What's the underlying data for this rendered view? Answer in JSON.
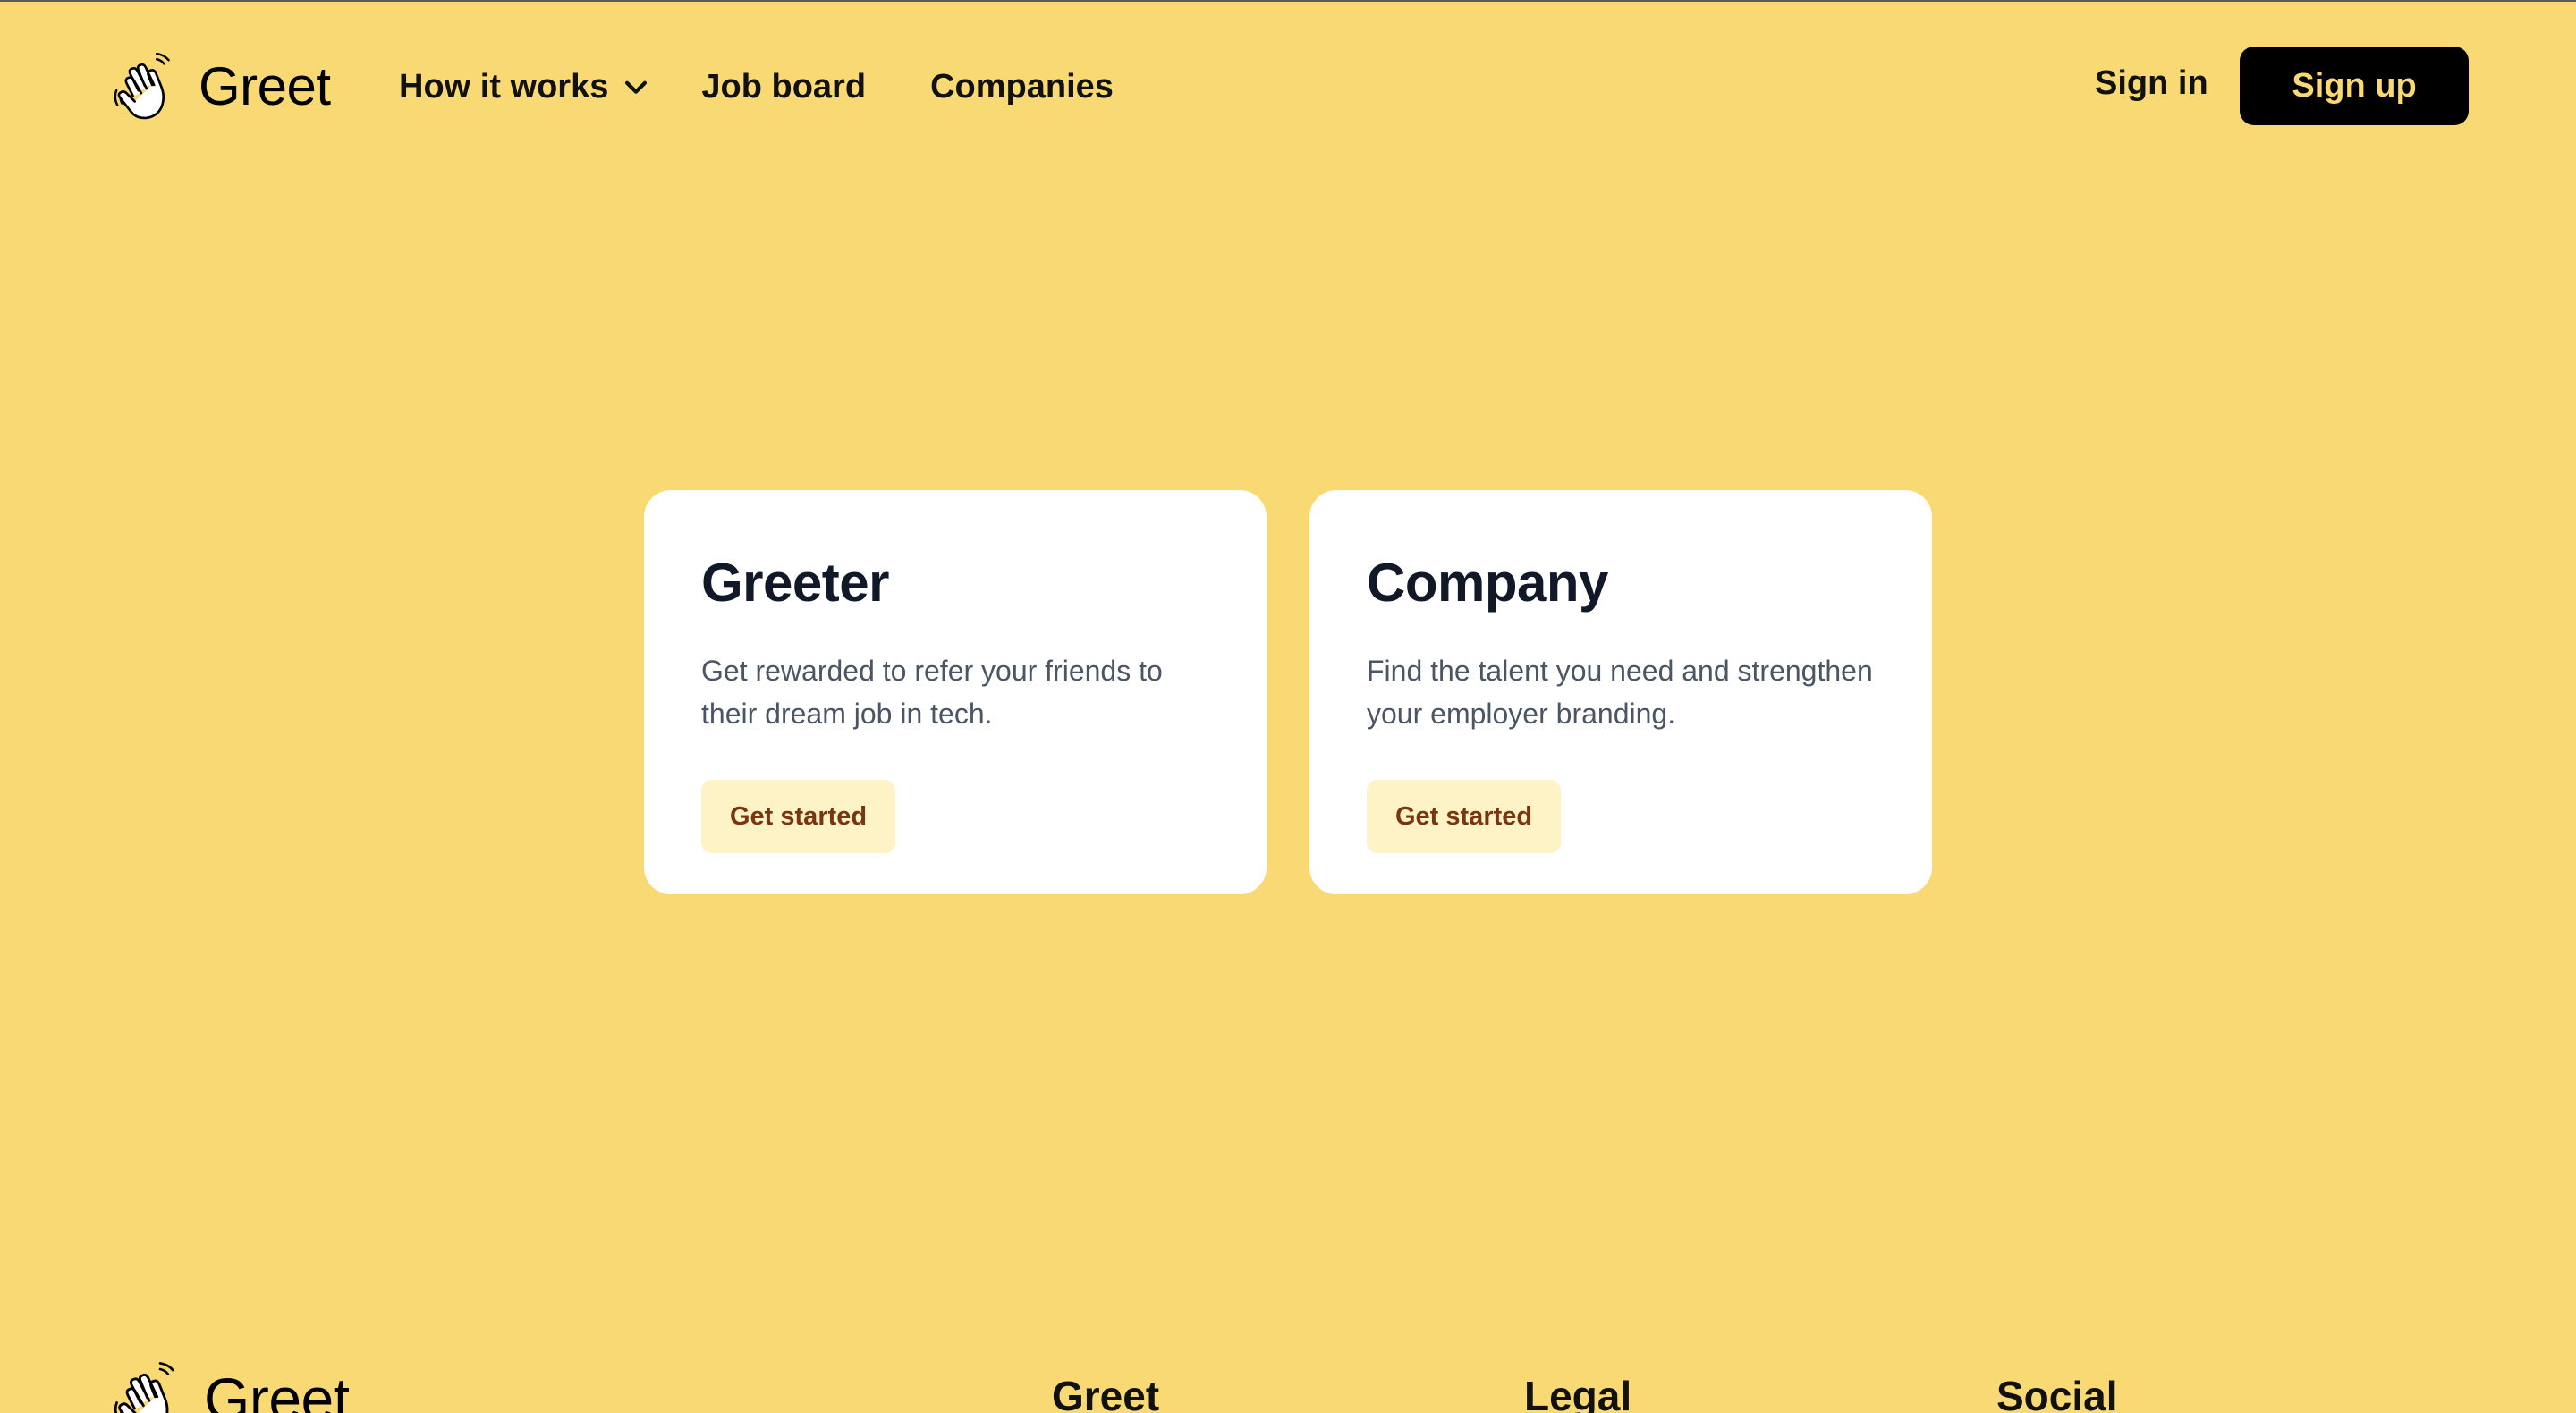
{
  "header": {
    "brand": "Greet",
    "nav": [
      {
        "label": "How it works",
        "has_dropdown": true
      },
      {
        "label": "Job board"
      },
      {
        "label": "Companies"
      }
    ],
    "sign_in": "Sign in",
    "sign_up": "Sign up"
  },
  "cards": [
    {
      "title": "Greeter",
      "description": "Get rewarded to refer your friends to their dream job in tech.",
      "cta": "Get started"
    },
    {
      "title": "Company",
      "description": "Find the talent you need and strengthen your employer branding.",
      "cta": "Get started"
    }
  ],
  "footer": {
    "brand": "Greet",
    "columns": [
      "Greet",
      "Legal",
      "Social"
    ]
  },
  "colors": {
    "background": "#f9d974",
    "signup_bg": "#000000",
    "signup_text": "#f9d974",
    "card_bg": "#ffffff",
    "cta_bg": "#fef3c7",
    "cta_text": "#78350f"
  },
  "icons": {
    "logo": "waving-hand-icon",
    "dropdown": "chevron-down-icon"
  }
}
